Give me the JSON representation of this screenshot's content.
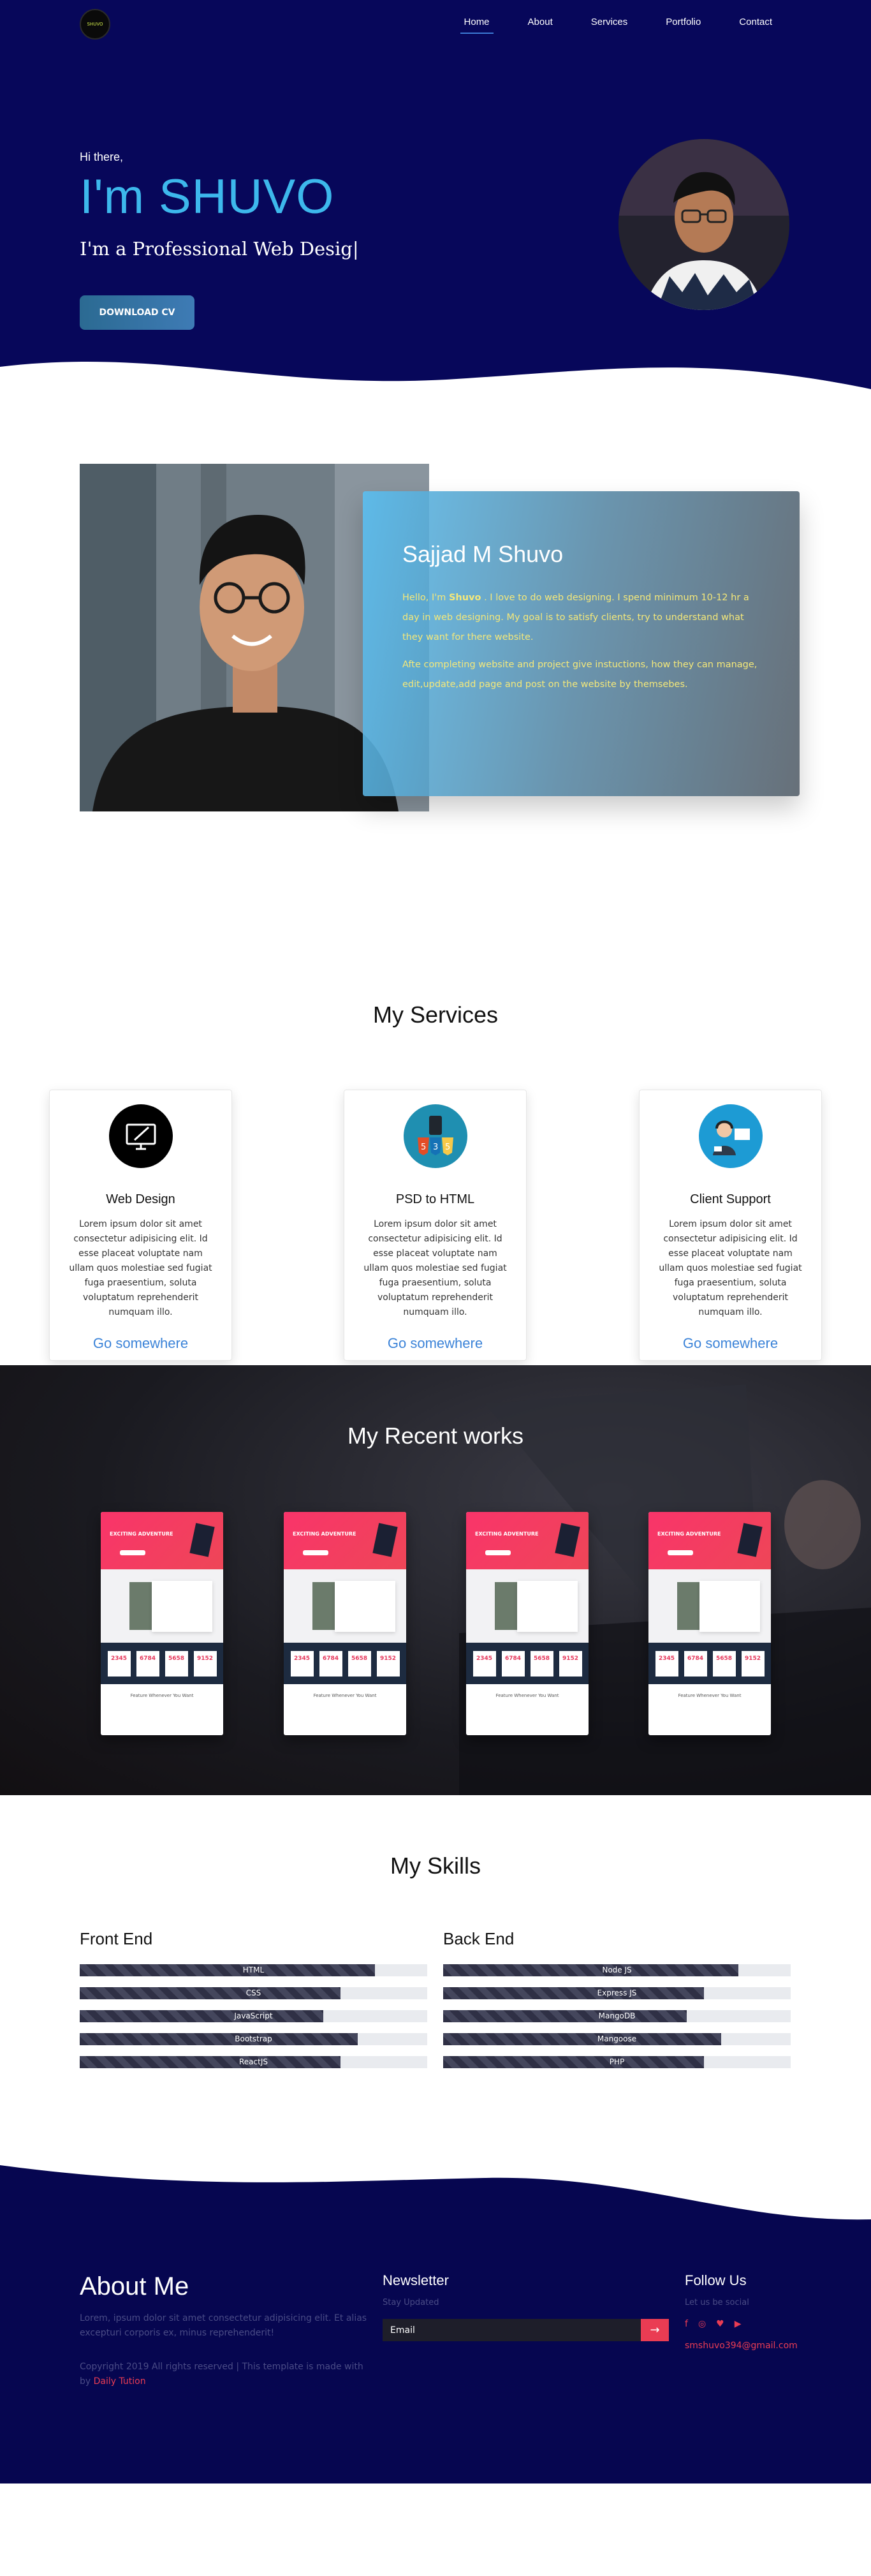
{
  "nav": {
    "logo_text": "SHUVO",
    "items": [
      {
        "label": "Home",
        "active": true
      },
      {
        "label": "About"
      },
      {
        "label": "Services"
      },
      {
        "label": "Portfolio"
      },
      {
        "label": "Contact"
      }
    ]
  },
  "hero": {
    "greeting": "Hi there,",
    "name": "I'm SHUVO",
    "role": "I'm a Professional Web Desig|",
    "cv_button": "DOWNLOAD CV"
  },
  "about": {
    "title": "Sajjad M Shuvo",
    "para1_pre": "Hello, I'm ",
    "para1_name": "Shuvo",
    "para1_post": " . I love to do web designing. I spend minimum 10-12 hr a day in web designing. My goal is to satisfy clients, try to understand what they want for there website.",
    "para2": "Afte completing website and project give instuctions, how they can manage, edit,update,add page and post on the website by themsebes."
  },
  "services": {
    "title": "My Services",
    "items": [
      {
        "name": "Web Design",
        "icon": "monitor-pen-icon",
        "text": "Lorem ipsum dolor sit amet consectetur adipisicing elit. Id esse placeat voluptate nam ullam quos molestiae sed fugiat fuga praesentium, soluta voluptatum reprehenderit numquam illo.",
        "link": "Go somewhere"
      },
      {
        "name": "PSD to HTML",
        "icon": "html-css-js-icon",
        "text": "Lorem ipsum dolor sit amet consectetur adipisicing elit. Id esse placeat voluptate nam ullam quos molestiae sed fugiat fuga praesentium, soluta voluptatum reprehenderit numquam illo.",
        "link": "Go somewhere"
      },
      {
        "name": "Client Support",
        "icon": "support-agent-icon",
        "text": "Lorem ipsum dolor sit amet consectetur adipisicing elit. Id esse placeat voluptate nam ullam quos molestiae sed fugiat fuga praesentium, soluta voluptatum reprehenderit numquam illo.",
        "link": "Go somewhere"
      }
    ]
  },
  "works": {
    "title": "My Recent works",
    "card_heading": "EXCITING ADVENTURE",
    "stats": [
      "2345",
      "6784",
      "5658",
      "9152"
    ],
    "card_footer": "Feature Whenever You Want"
  },
  "skills": {
    "title": "My Skills",
    "front": {
      "title": "Front End",
      "items": [
        {
          "label": "HTML",
          "value": 85
        },
        {
          "label": "CSS",
          "value": 75
        },
        {
          "label": "JavaScript",
          "value": 70
        },
        {
          "label": "Bootstrap",
          "value": 80
        },
        {
          "label": "ReactJS",
          "value": 75
        }
      ]
    },
    "back": {
      "title": "Back End",
      "items": [
        {
          "label": "Node JS",
          "value": 85
        },
        {
          "label": "Express JS",
          "value": 75
        },
        {
          "label": "MangoDB",
          "value": 70
        },
        {
          "label": "Mangoose",
          "value": 80
        },
        {
          "label": "PHP",
          "value": 75
        }
      ]
    }
  },
  "footer": {
    "about_title": "About Me",
    "about_text": "Lorem, ipsum dolor sit amet consectetur adipisicing elit. Et alias excepturi corporis ex, minus reprehenderit!",
    "copyright": "Copyright 2019 All rights reserved | This template is made with by ",
    "copyright_link": "Daily Tution",
    "newsletter_title": "Newsletter",
    "newsletter_sub": "Stay Updated",
    "email_placeholder": "Email",
    "follow_title": "Follow Us",
    "follow_sub": "Let us be social",
    "socials": [
      "facebook-icon",
      "instagram-icon",
      "twitter-icon",
      "youtube-icon"
    ],
    "email": "smshuvo394@gmail.com"
  }
}
